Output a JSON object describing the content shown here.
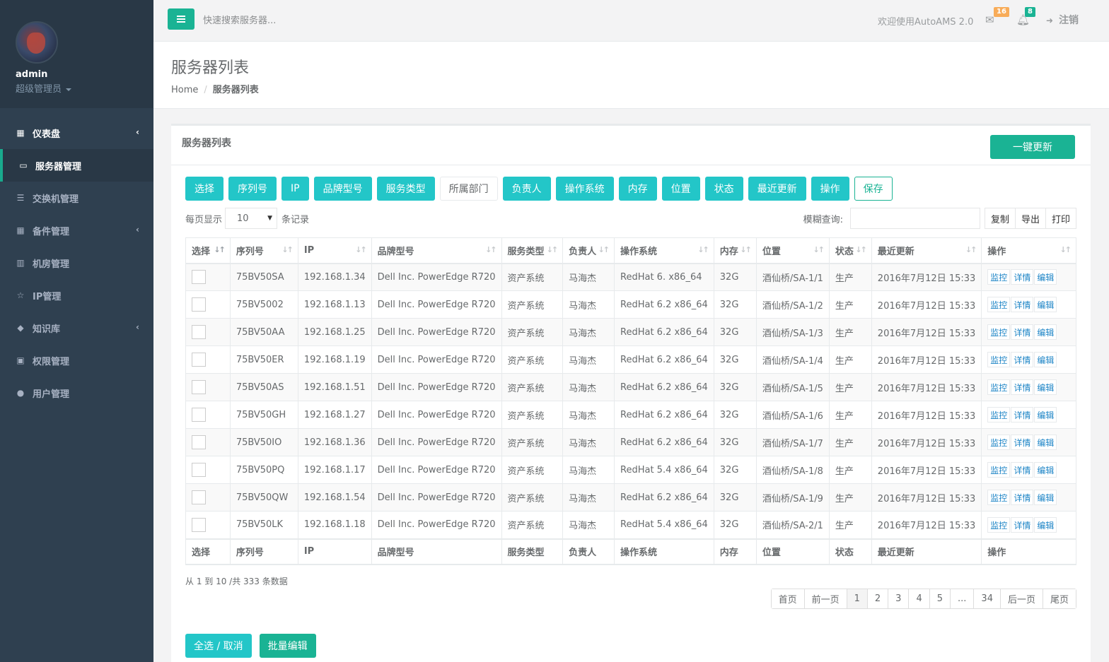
{
  "sidebar": {
    "profile": {
      "name": "admin",
      "role": "超级管理员"
    },
    "items": [
      {
        "label": "仪表盘",
        "icon": "dashboard-icon",
        "glyph": "▦",
        "arrow": "‹"
      },
      {
        "label": "服务器管理",
        "icon": "laptop-icon",
        "glyph": "▭",
        "arrow": ""
      },
      {
        "label": "交换机管理",
        "icon": "list-icon",
        "glyph": "☰",
        "arrow": ""
      },
      {
        "label": "备件管理",
        "icon": "grid-icon",
        "glyph": "▦",
        "arrow": "‹"
      },
      {
        "label": "机房管理",
        "icon": "building-icon",
        "glyph": "▥",
        "arrow": ""
      },
      {
        "label": "IP管理",
        "icon": "star-icon",
        "glyph": "☆",
        "arrow": ""
      },
      {
        "label": "知识库",
        "icon": "graduation-cap-icon",
        "glyph": "◆",
        "arrow": "‹"
      },
      {
        "label": "权限管理",
        "icon": "lock-icon",
        "glyph": "▣",
        "arrow": ""
      },
      {
        "label": "用户管理",
        "icon": "user-icon",
        "glyph": "●",
        "arrow": ""
      }
    ]
  },
  "topbar": {
    "search_placeholder": "快速搜索服务器...",
    "welcome": "欢迎使用AutoAMS 2.0",
    "mail_count": "16",
    "bell_count": "8",
    "logout": "注销"
  },
  "heading": {
    "title": "服务器列表",
    "breadcrumb_home": "Home",
    "breadcrumb_sep": "/",
    "breadcrumb_current": "服务器列表"
  },
  "panel": {
    "title": "服务器列表",
    "update_button": "一键更新",
    "toggles": [
      {
        "label": "选择",
        "state": "on"
      },
      {
        "label": "序列号",
        "state": "on"
      },
      {
        "label": "IP",
        "state": "on"
      },
      {
        "label": "品牌型号",
        "state": "on"
      },
      {
        "label": "服务类型",
        "state": "on"
      },
      {
        "label": "所属部门",
        "state": "off"
      },
      {
        "label": "负责人",
        "state": "on"
      },
      {
        "label": "操作系统",
        "state": "on"
      },
      {
        "label": "内存",
        "state": "on"
      },
      {
        "label": "位置",
        "state": "on"
      },
      {
        "label": "状态",
        "state": "on"
      },
      {
        "label": "最近更新",
        "state": "on"
      },
      {
        "label": "操作",
        "state": "on"
      },
      {
        "label": "保存",
        "state": "save"
      }
    ],
    "length_prefix": "每页显示",
    "length_value": "10",
    "length_suffix": "条记录",
    "filter_label": "模糊查询:",
    "tools": [
      "复制",
      "导出",
      "打印"
    ]
  },
  "table": {
    "columns": [
      "选择",
      "序列号",
      "IP",
      "品牌型号",
      "服务类型",
      "负责人",
      "操作系统",
      "内存",
      "位置",
      "状态",
      "最近更新",
      "操作"
    ],
    "actions": [
      "监控",
      "详情",
      "编辑"
    ],
    "rows": [
      [
        "75BV50SA",
        "192.168.1.34",
        "Dell Inc. PowerEdge R720",
        "资产系统",
        "马海杰",
        "RedHat 6. x86_64",
        "32G",
        "酒仙桥/SA-1/1",
        "生产",
        "2016年7月12日 15:33"
      ],
      [
        "75BV5002",
        "192.168.1.13",
        "Dell Inc. PowerEdge R720",
        "资产系统",
        "马海杰",
        "RedHat 6.2 x86_64",
        "32G",
        "酒仙桥/SA-1/2",
        "生产",
        "2016年7月12日 15:33"
      ],
      [
        "75BV50AA",
        "192.168.1.25",
        "Dell Inc. PowerEdge R720",
        "资产系统",
        "马海杰",
        "RedHat 6.2 x86_64",
        "32G",
        "酒仙桥/SA-1/3",
        "生产",
        "2016年7月12日 15:33"
      ],
      [
        "75BV50ER",
        "192.168.1.19",
        "Dell Inc. PowerEdge R720",
        "资产系统",
        "马海杰",
        "RedHat 6.2 x86_64",
        "32G",
        "酒仙桥/SA-1/4",
        "生产",
        "2016年7月12日 15:33"
      ],
      [
        "75BV50AS",
        "192.168.1.51",
        "Dell Inc. PowerEdge R720",
        "资产系统",
        "马海杰",
        "RedHat 6.2 x86_64",
        "32G",
        "酒仙桥/SA-1/5",
        "生产",
        "2016年7月12日 15:33"
      ],
      [
        "75BV50GH",
        "192.168.1.27",
        "Dell Inc. PowerEdge R720",
        "资产系统",
        "马海杰",
        "RedHat 6.2 x86_64",
        "32G",
        "酒仙桥/SA-1/6",
        "生产",
        "2016年7月12日 15:33"
      ],
      [
        "75BV50IO",
        "192.168.1.36",
        "Dell Inc. PowerEdge R720",
        "资产系统",
        "马海杰",
        "RedHat 6.2 x86_64",
        "32G",
        "酒仙桥/SA-1/7",
        "生产",
        "2016年7月12日 15:33"
      ],
      [
        "75BV50PQ",
        "192.168.1.17",
        "Dell Inc. PowerEdge R720",
        "资产系统",
        "马海杰",
        "RedHat 5.4 x86_64",
        "32G",
        "酒仙桥/SA-1/8",
        "生产",
        "2016年7月12日 15:33"
      ],
      [
        "75BV50QW",
        "192.168.1.54",
        "Dell Inc. PowerEdge R720",
        "资产系统",
        "马海杰",
        "RedHat 6.2 x86_64",
        "32G",
        "酒仙桥/SA-1/9",
        "生产",
        "2016年7月12日 15:33"
      ],
      [
        "75BV50LK",
        "192.168.1.18",
        "Dell Inc. PowerEdge R720",
        "资产系统",
        "马海杰",
        "RedHat 5.4 x86_64",
        "32G",
        "酒仙桥/SA-2/1",
        "生产",
        "2016年7月12日 15:33"
      ]
    ]
  },
  "footer": {
    "info": "从 1 到 10 /共 333 条数据",
    "pagination": [
      "首页",
      "前一页",
      "1",
      "2",
      "3",
      "4",
      "5",
      "...",
      "34",
      "后一页",
      "尾页"
    ],
    "active_page": "1",
    "select_all": "全选 / 取消",
    "batch_edit": "批量编辑"
  },
  "colors": {
    "primary": "#1ab394",
    "info": "#23c6c8",
    "sidebar": "#2f4050",
    "link": "#1c84c6"
  }
}
